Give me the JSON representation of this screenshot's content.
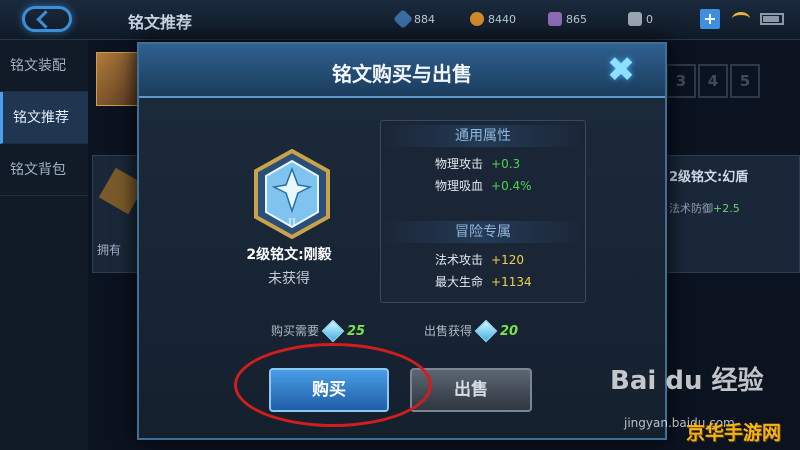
{
  "topbar": {
    "title": "铭文推荐",
    "resources": [
      {
        "icon": "blue-diamond-icon",
        "value": "884"
      },
      {
        "icon": "gold-coin-icon",
        "value": "8440"
      },
      {
        "icon": "purple-gem-icon",
        "value": "865"
      },
      {
        "icon": "card-icon",
        "value": "0"
      }
    ],
    "plus": "+"
  },
  "sidebar": {
    "items": [
      {
        "label": "铭文装配"
      },
      {
        "label": "铭文推荐"
      },
      {
        "label": "铭文背包"
      }
    ]
  },
  "background": {
    "left_card_text": "拥有",
    "slots": [
      "3",
      "4",
      "5"
    ],
    "right_card_title": "2级铭文:幻盾",
    "right_card_attr": "法术防御",
    "right_card_value": "+2.5"
  },
  "dialog": {
    "title": "铭文购买与出售",
    "close": "✖",
    "rune": {
      "name": "2级铭文:刚毅",
      "status": "未获得",
      "level_mark": "II"
    },
    "general_title": "通用属性",
    "general_attrs": [
      {
        "name": "物理攻击",
        "value": "+0.3"
      },
      {
        "name": "物理吸血",
        "value": "+0.4%"
      }
    ],
    "adventure_title": "冒险专属",
    "adventure_attrs": [
      {
        "name": "法术攻击",
        "value": "+120"
      },
      {
        "name": "最大生命",
        "value": "+1134"
      }
    ],
    "buy_need_label": "购买需要",
    "buy_need_value": "25",
    "sell_get_label": "出售获得",
    "sell_get_value": "20",
    "buy_button": "购买",
    "sell_button": "出售"
  },
  "watermark": {
    "baidu": "Bai du 经验",
    "url": "jingyan.baidu.com",
    "site": "京华手游网"
  },
  "colors": {
    "highlight_circle": "#d21d1d",
    "attr_green": "#4fd34f",
    "attr_yellow": "#f1d04a",
    "price_green": "#7be24a"
  }
}
